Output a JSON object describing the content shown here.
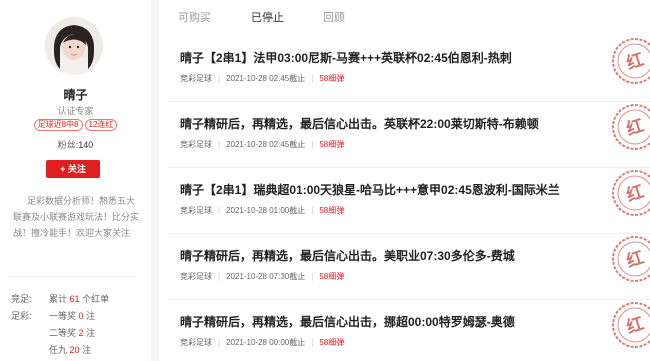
{
  "profile": {
    "name": "晴子",
    "verified": "认证专家",
    "tags": [
      "足球近8中8",
      "12连红"
    ],
    "fans_label": "粉丝:",
    "fans_count": "140",
    "follow_label": "+ 关注",
    "bio": "足彩数据分析师！熟悉五大联赛及小联赛游戏玩法！比分实战！擅冷能手！欢迎大家关注"
  },
  "stats": [
    {
      "key": "竞足:",
      "prefix": "累计",
      "value": "61",
      "suffix": "个红单"
    },
    {
      "key": "足彩:",
      "prefix": "一等奖",
      "value": "0",
      "suffix": "注"
    },
    {
      "key": "",
      "prefix": "二等奖",
      "value": "2",
      "suffix": "注"
    },
    {
      "key": "",
      "prefix": "任九",
      "value": "20",
      "suffix": "注"
    }
  ],
  "tabs": [
    {
      "label": "可购买",
      "active": false
    },
    {
      "label": "已停止",
      "active": true
    },
    {
      "label": "回顾",
      "active": false
    }
  ],
  "items": [
    {
      "title": "晴子【2串1】法甲03:00尼斯-马赛+++英联杯02:45伯恩利-热刺",
      "category": "竞彩足球",
      "time": "2021-10-28 02:45截止",
      "price": "58细弹",
      "stamp": "红"
    },
    {
      "title": "晴子精研后，再精选，最后信心出击。英联杯22:00莱切斯特-布赖顿",
      "category": "竞彩足球",
      "time": "2021-10-28 02:45截止",
      "price": "58细弹",
      "stamp": "红"
    },
    {
      "title": "晴子【2串1】瑞典超01:00天狼星-哈马比+++意甲02:45恩波利-国际米兰",
      "category": "竞彩足球",
      "time": "2021-10-28 01:00截止",
      "price": "58细弹",
      "stamp": "红"
    },
    {
      "title": "晴子精研后，再精选，最后信心出击。美职业07:30多伦多-费城",
      "category": "竞彩足球",
      "time": "2021-10-28 07:30截止",
      "price": "58细弹",
      "stamp": "红"
    },
    {
      "title": "晴子精研后，再精选，最后信心出击，挪超00:00特罗姆瑟-奥德",
      "category": "竞彩足球",
      "time": "2021-10-28 00:00截止",
      "price": "58细弹",
      "stamp": "红"
    }
  ],
  "colors": {
    "accent": "#e02020",
    "stamp": "#c84640"
  }
}
